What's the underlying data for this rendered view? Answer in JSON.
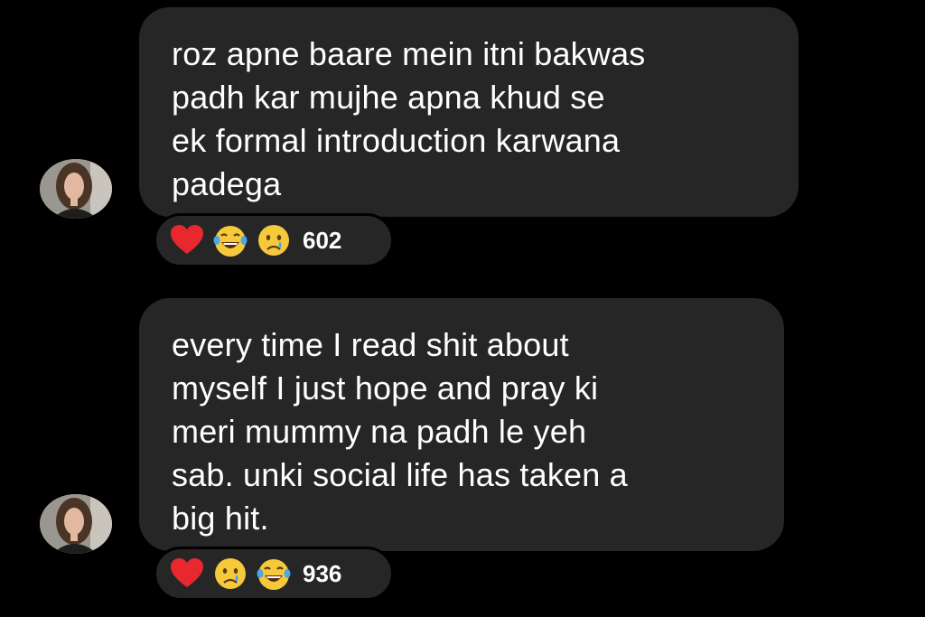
{
  "comments": [
    {
      "lines": [
        "roz apne baare mein itni bakwas",
        "padh kar mujhe apna khud se",
        "ek formal introduction karwana",
        "padega"
      ],
      "reactions": [
        "heart-icon",
        "laughing-face-icon",
        "crying-face-icon"
      ],
      "reaction_count": "602"
    },
    {
      "lines": [
        "every time I read shit about",
        "myself I just hope and pray ki",
        "meri mummy na padh le yeh",
        "sab. unki social life has taken a",
        "big hit."
      ],
      "reactions": [
        "heart-icon",
        "crying-face-icon",
        "laughing-face-icon"
      ],
      "reaction_count": "936"
    }
  ],
  "colors": {
    "background": "#000000",
    "bubble": "#262626",
    "text": "#ffffff",
    "heart": "#e8282e",
    "emoji_face": "#f5c93a",
    "tear": "#4aa8e8"
  }
}
